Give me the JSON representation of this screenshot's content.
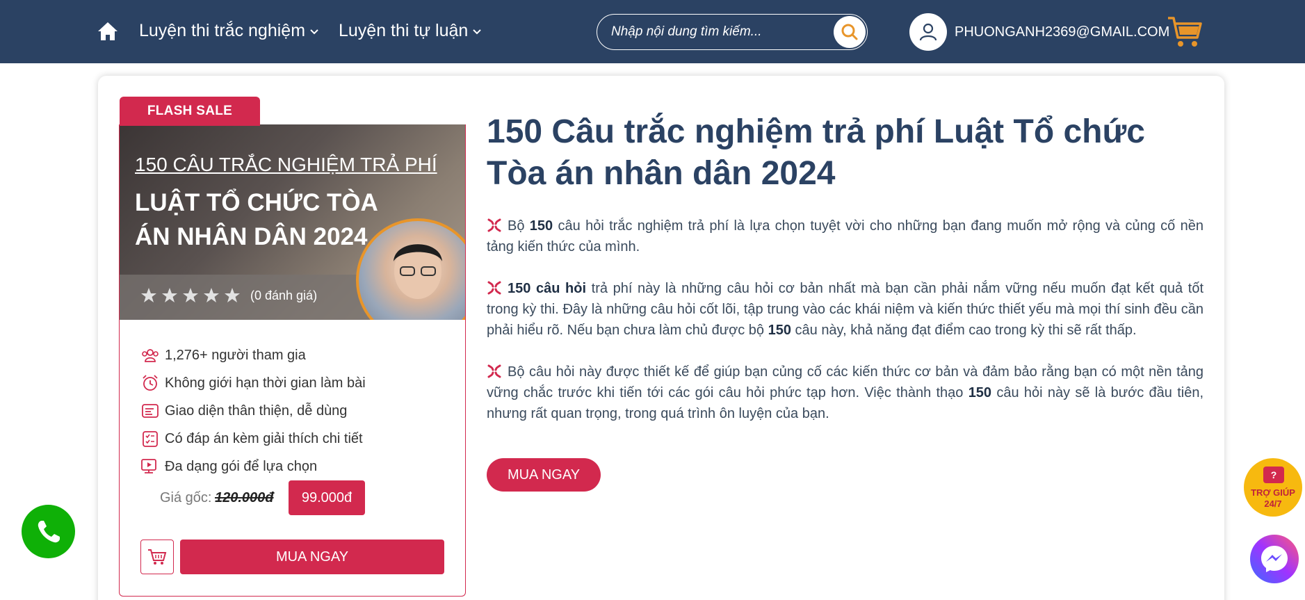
{
  "header": {
    "nav": [
      {
        "label": "Luyện thi trắc nghiệm"
      },
      {
        "label": "Luyện thi tự luận"
      }
    ],
    "search": {
      "placeholder": "Nhập nội dung tìm kiếm..."
    },
    "user_email": "PHUONGANH2369@GMAIL.COM",
    "colors": {
      "bar": "#2b4263",
      "search_icon": "#e8952a",
      "cart_icon": "#e8952a"
    }
  },
  "product": {
    "flash_label": "FLASH SALE",
    "banner_line1": "150 CÂU TRẮC NGHIỆM TRẢ PHÍ",
    "banner_line2": "LUẬT TỔ CHỨC TÒA ÁN NHÂN DÂN 2024",
    "rating": 0,
    "rating_text": "(0 đánh giá)",
    "features": [
      {
        "icon": "users-icon",
        "text": "1,276+ người tham gia"
      },
      {
        "icon": "alarm-clock-icon",
        "text": "Không giới hạn thời gian làm bài"
      },
      {
        "icon": "interface-icon",
        "text": "Giao diện thân thiện, dễ dùng"
      },
      {
        "icon": "checklist-icon",
        "text": "Có đáp án kèm giải thích chi tiết"
      },
      {
        "icon": "video-screen-icon",
        "text": "Đa dạng gói để lựa chọn"
      }
    ],
    "price_label": "Giá gốc:",
    "price_old": "120.000đ",
    "price_new": "99.000đ",
    "buy_label": "MUA NGAY",
    "accent": "#d2294e"
  },
  "content": {
    "title": "150 Câu trắc nghiệm trả phí Luật Tổ chức Tòa án nhân dân 2024",
    "p1": {
      "a": "Bộ ",
      "b": "150",
      "c": " câu hỏi trắc nghiệm trả phí là lựa chọn tuyệt vời cho những bạn đang muốn mở rộng và củng cố nền tảng kiến thức của mình."
    },
    "p2": {
      "a": "150 câu hỏi",
      "b": " trả phí này là những câu hỏi cơ bản nhất mà bạn cần phải nắm vững nếu muốn đạt kết quả tốt trong kỳ thi. Đây là những câu hỏi cốt lõi, tập trung vào các khái niệm và kiến thức thiết yếu mà mọi thí sinh đều cần phải hiểu rõ. Nếu bạn chưa làm chủ được bộ ",
      "c": "150",
      "d": " câu này, khả năng đạt điểm cao trong kỳ thi sẽ rất thấp."
    },
    "p3": {
      "a": "Bộ câu hỏi này được thiết kế để giúp bạn củng cố các kiến thức cơ bản và đảm bảo rằng bạn có một nền tảng vững chắc trước khi tiến tới các gói câu hỏi phức tạp hơn. Việc thành thạo ",
      "b": "150",
      "c": " câu hỏi này sẽ là bước đầu tiên, nhưng rất quan trọng, trong quá trình ôn luyện của bạn."
    },
    "buy_label": "MUA NGAY"
  },
  "floating": {
    "help_badge": "?",
    "help_line1": "TRỢ GIÚP",
    "help_line2": "24/7"
  }
}
